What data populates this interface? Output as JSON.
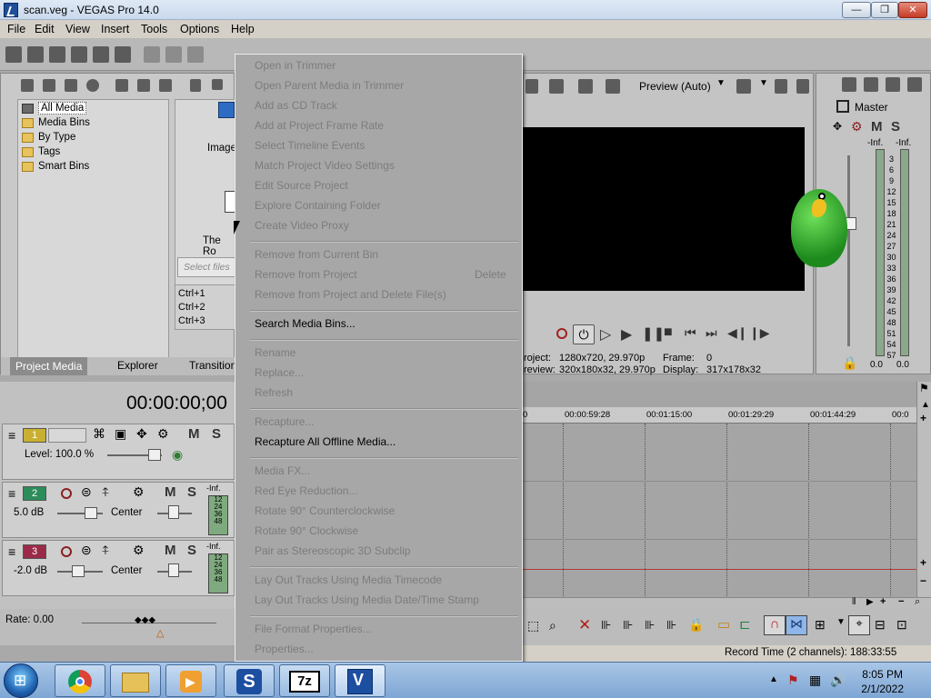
{
  "window": {
    "title": "scan.veg - VEGAS Pro 14.0",
    "minimize": "—",
    "restore": "❐",
    "close": "✕"
  },
  "menubar": {
    "items": [
      "File",
      "Edit",
      "View",
      "Insert",
      "Tools",
      "Options",
      "Help"
    ]
  },
  "project_media": {
    "tree": [
      "All Media",
      "Media Bins",
      "By Type",
      "Tags",
      "Smart Bins"
    ],
    "thumb_labels": [
      "Image",
      "The Ro"
    ],
    "search_placeholder": "Select files",
    "shortcuts": [
      "Ctrl+1",
      "Ctrl+2",
      "Ctrl+3"
    ],
    "tabs": [
      "Project Media",
      "Explorer",
      "Transitions"
    ]
  },
  "preview": {
    "quality": "Preview (Auto)",
    "project_label": "roject:",
    "project_value": "1280x720, 29.970p",
    "frame_label": "Frame:",
    "frame_value": "0",
    "preview_label": "review:",
    "preview_value": "320x180x32, 29.970p",
    "display_label": "Display:",
    "display_value": "317x178x32"
  },
  "mixer": {
    "master_label": "Master",
    "left_peak": "-Inf.",
    "right_peak": "-Inf.",
    "scale": [
      "3",
      "6",
      "9",
      "12",
      "15",
      "18",
      "21",
      "24",
      "27",
      "30",
      "33",
      "36",
      "39",
      "42",
      "45",
      "48",
      "51",
      "54",
      "57"
    ],
    "bottom_left": "0.0",
    "bottom_right": "0.0",
    "m": "M",
    "s": "S"
  },
  "timeline": {
    "timecode": "00:00:00;00",
    "ruler": [
      "00:00:59:28",
      "00:01:15:00",
      "00:01:29:29",
      "00:01:44:29",
      "00:0"
    ],
    "ruler_start": "0",
    "rate": "Rate: 0.00",
    "record_time": "Record Time (2 channels): 188:33:55"
  },
  "tracks": [
    {
      "num": "1",
      "color": "#c9b032",
      "level": "Level: 100.0 %",
      "m": "M",
      "s": "S"
    },
    {
      "num": "2",
      "color": "#2c8d5a",
      "vol": "5.0 dB",
      "pan": "Center",
      "peak": "-Inf.",
      "mini": [
        "12",
        "24",
        "36",
        "48"
      ],
      "m": "M",
      "s": "S"
    },
    {
      "num": "3",
      "color": "#9a2a48",
      "vol": "-2.0 dB",
      "pan": "Center",
      "peak": "-Inf.",
      "mini": [
        "12",
        "24",
        "36",
        "48"
      ],
      "m": "M",
      "s": "S"
    }
  ],
  "context_menu": {
    "items": [
      {
        "label": "Open in Trimmer",
        "enabled": false
      },
      {
        "label": "Open Parent Media in Trimmer",
        "enabled": false
      },
      {
        "label": "Add as CD Track",
        "enabled": false
      },
      {
        "label": "Add at Project Frame Rate",
        "enabled": false
      },
      {
        "label": "Select Timeline Events",
        "enabled": false
      },
      {
        "label": "Match Project Video Settings",
        "enabled": false
      },
      {
        "label": "Edit Source Project",
        "enabled": false
      },
      {
        "label": "Explore Containing Folder",
        "enabled": false
      },
      {
        "label": "Create Video Proxy",
        "enabled": false
      },
      {
        "label": "Remove from Current Bin",
        "enabled": false
      },
      {
        "label": "Remove from Project",
        "enabled": false,
        "shortcut": "Delete"
      },
      {
        "label": "Remove from Project and Delete File(s)",
        "enabled": false
      },
      {
        "label": "Search Media Bins...",
        "enabled": true
      },
      {
        "label": "Rename",
        "enabled": false
      },
      {
        "label": "Replace...",
        "enabled": false
      },
      {
        "label": "Refresh",
        "enabled": false
      },
      {
        "label": "Recapture...",
        "enabled": false
      },
      {
        "label": "Recapture All Offline Media...",
        "enabled": true
      },
      {
        "label": "Media FX...",
        "enabled": false
      },
      {
        "label": "Red Eye Reduction...",
        "enabled": false
      },
      {
        "label": "Rotate 90° Counterclockwise",
        "enabled": false
      },
      {
        "label": "Rotate 90° Clockwise",
        "enabled": false
      },
      {
        "label": "Pair as Stereoscopic 3D Subclip",
        "enabled": false
      },
      {
        "label": "Lay Out Tracks Using Media Timecode",
        "enabled": false
      },
      {
        "label": "Lay Out Tracks Using Media Date/Time Stamp",
        "enabled": false
      },
      {
        "label": "File Format Properties...",
        "enabled": false
      },
      {
        "label": "Properties...",
        "enabled": false
      }
    ]
  },
  "taskbar": {
    "apps": [
      "chrome-icon",
      "explorer-icon",
      "media-player-icon",
      "vegas-s-icon",
      "7zip-icon",
      "vegas-pro-icon"
    ],
    "s_label": "S",
    "zip_label": "7z",
    "time": "8:05 PM",
    "date": "2/1/2022"
  }
}
